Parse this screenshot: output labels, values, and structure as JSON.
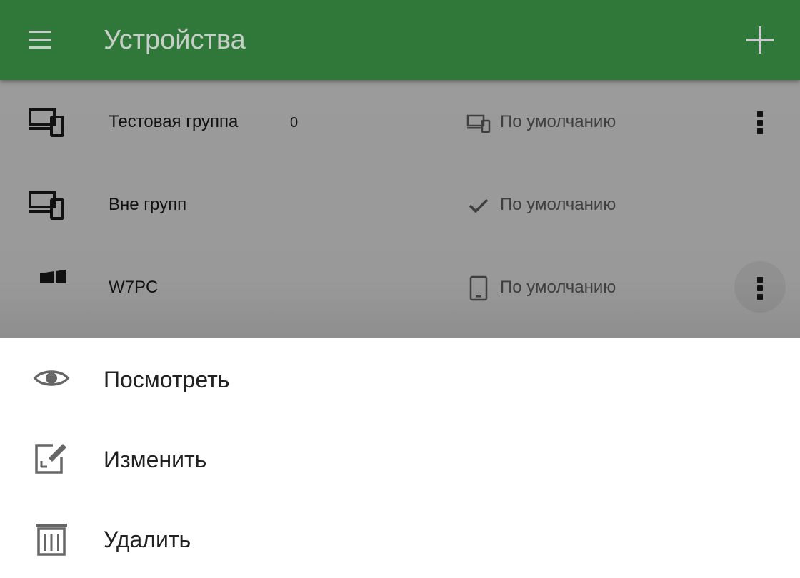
{
  "header": {
    "title": "Устройства",
    "menu_icon": "menu-icon",
    "add_icon": "add-icon",
    "background": "#30773a"
  },
  "rows": [
    {
      "name": "Тестовая группа",
      "count": "0",
      "icon": "devices-icon",
      "status_icon": "devices-icon",
      "status": "По умолчанию",
      "has_menu": true
    },
    {
      "name": "Вне групп",
      "icon": "devices-icon",
      "status_icon": "check-icon",
      "status": "По умолчанию",
      "has_menu": false
    },
    {
      "name": "W7PC",
      "icon": "windows-icon",
      "status_icon": "tablet-icon",
      "status": "По умолчанию",
      "has_menu": true
    }
  ],
  "sheet": {
    "items": [
      {
        "label": "Посмотреть",
        "icon": "eye-icon"
      },
      {
        "label": "Изменить",
        "icon": "edit-icon"
      },
      {
        "label": "Удалить",
        "icon": "trash-icon"
      }
    ]
  }
}
